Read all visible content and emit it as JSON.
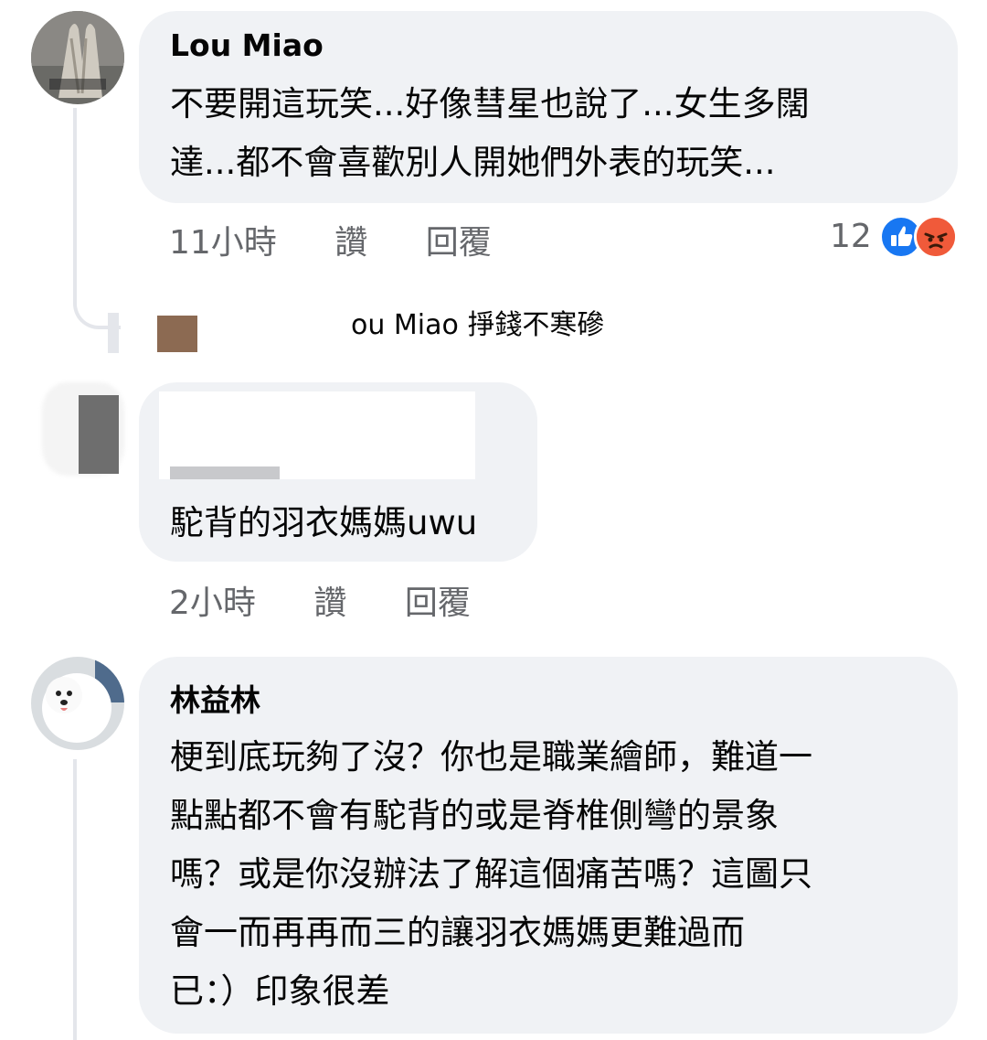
{
  "comments": [
    {
      "author": "Lou Miao",
      "text_lines": [
        "不要開這玩笑...好像彗星也說了...女生多闊",
        "達...都不會喜歡別人開她們外表的玩笑..."
      ],
      "time": "11小時",
      "like_label": "讚",
      "reply_label": "回覆",
      "reaction_count": "12",
      "reactions": [
        "like-icon",
        "angry-icon"
      ]
    },
    {
      "reply_preview": "ou Miao 掙錢不寒磣"
    },
    {
      "author": "",
      "text_lines": [
        "駝背的羽衣媽媽uwu"
      ],
      "time": "2小時",
      "like_label": "讚",
      "reply_label": "回覆"
    },
    {
      "author": "林益林",
      "text_lines": [
        "梗到底玩夠了沒？你也是職業繪師，難道一",
        "點點都不會有駝背的或是脊椎側彎的景象",
        "嗎？或是你沒辦法了解這個痛苦嗎？這圖只",
        "會一而再再而三的讓羽衣媽媽更難過而",
        "已：）印象很差"
      ]
    }
  ],
  "colors": {
    "bubble": "#f0f2f5",
    "meta_text": "#65676b",
    "like_blue": "#1877f2",
    "angry_orange": "#f7714c"
  }
}
